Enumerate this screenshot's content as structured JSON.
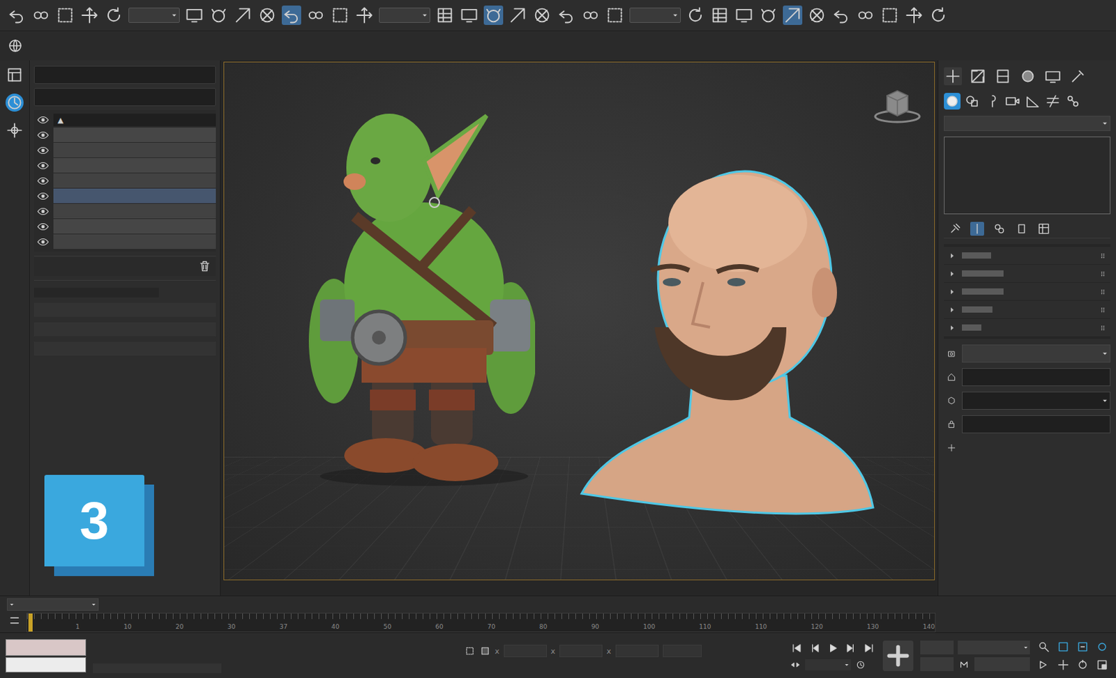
{
  "logo": {
    "label": "3"
  },
  "toolbar": {
    "items": [
      {
        "kind": "icon",
        "selected": false
      },
      {
        "kind": "icon",
        "selected": false
      },
      {
        "kind": "icon",
        "selected": false
      },
      {
        "kind": "icon",
        "selected": false
      },
      {
        "kind": "icon",
        "selected": false
      },
      {
        "kind": "dropdown",
        "selected": false
      },
      {
        "kind": "icon",
        "selected": false
      },
      {
        "kind": "icon",
        "selected": false
      },
      {
        "kind": "icon",
        "selected": false
      },
      {
        "kind": "icon",
        "selected": false
      },
      {
        "kind": "icon",
        "selected": true
      },
      {
        "kind": "icon",
        "selected": false
      },
      {
        "kind": "icon",
        "selected": false
      },
      {
        "kind": "icon",
        "selected": false
      },
      {
        "kind": "dropdown",
        "selected": false
      },
      {
        "kind": "icon",
        "selected": false
      },
      {
        "kind": "icon",
        "selected": false
      },
      {
        "kind": "icon",
        "selected": true
      },
      {
        "kind": "icon",
        "selected": false
      },
      {
        "kind": "icon",
        "selected": false
      },
      {
        "kind": "icon",
        "selected": false
      },
      {
        "kind": "icon",
        "selected": false
      },
      {
        "kind": "icon",
        "selected": false
      },
      {
        "kind": "dropdown",
        "selected": false
      },
      {
        "kind": "icon",
        "selected": false
      },
      {
        "kind": "icon",
        "selected": false
      },
      {
        "kind": "icon",
        "selected": false
      },
      {
        "kind": "icon",
        "selected": false
      },
      {
        "kind": "icon",
        "selected": true
      },
      {
        "kind": "icon",
        "selected": false
      },
      {
        "kind": "icon",
        "selected": false
      },
      {
        "kind": "icon",
        "selected": false
      },
      {
        "kind": "icon",
        "selected": false
      },
      {
        "kind": "icon",
        "selected": false
      },
      {
        "kind": "icon",
        "selected": false
      }
    ]
  },
  "left_strip": {
    "tools": [
      {
        "selected": false
      },
      {
        "selected": true
      },
      {
        "selected": false
      }
    ]
  },
  "scene_explorer": {
    "header_icon": "▲",
    "rows": [
      {
        "visible": true,
        "selected": false
      },
      {
        "visible": true,
        "selected": false
      },
      {
        "visible": true,
        "selected": false
      },
      {
        "visible": true,
        "selected": false
      },
      {
        "visible": true,
        "selected": true
      },
      {
        "visible": true,
        "selected": false
      },
      {
        "visible": true,
        "selected": false
      },
      {
        "visible": true,
        "selected": false
      }
    ]
  },
  "viewport": {
    "objects": [
      {
        "kind": "goblin",
        "selected": false
      },
      {
        "kind": "bust",
        "selected": true
      }
    ]
  },
  "command_panel": {
    "tabs": [
      {
        "selected": true
      },
      {
        "selected": false
      },
      {
        "selected": false
      },
      {
        "selected": false
      },
      {
        "selected": false
      },
      {
        "selected": false
      }
    ],
    "categories": [
      {
        "selected": true
      },
      {
        "selected": false
      },
      {
        "selected": false
      },
      {
        "selected": false
      },
      {
        "selected": false
      },
      {
        "selected": false
      },
      {
        "selected": false
      }
    ],
    "rollouts": [
      {
        "expanded": false
      },
      {
        "expanded": false
      },
      {
        "expanded": false
      },
      {
        "expanded": false
      },
      {
        "expanded": false
      }
    ]
  },
  "timeline": {
    "level": 0,
    "ticks": [
      "1",
      "10",
      "20",
      "30",
      "37",
      "40",
      "50",
      "60",
      "70",
      "80",
      "90",
      "100",
      "110",
      "110",
      "120",
      "130",
      "140"
    ]
  },
  "coordinates": {
    "axes": [
      "x",
      "x",
      "x"
    ]
  }
}
